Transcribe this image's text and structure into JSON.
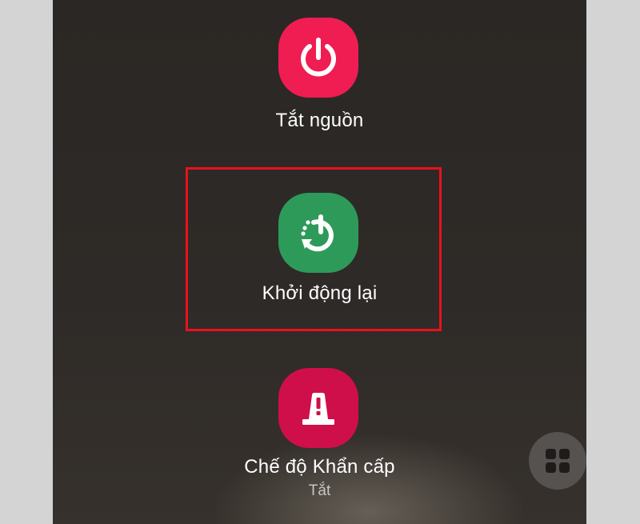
{
  "power_menu": {
    "options": [
      {
        "label": "Tắt nguồn",
        "icon": "power-icon",
        "color": "#ef1d52"
      },
      {
        "label": "Khởi động lại",
        "icon": "restart-icon",
        "color": "#2e9a5a",
        "highlighted": true
      },
      {
        "label": "Chế độ Khẩn cấp",
        "sublabel": "Tắt",
        "icon": "emergency-beacon-icon",
        "color": "#cf0f4a"
      }
    ],
    "grid_button": {
      "icon": "grid-icon"
    },
    "highlight_color": "#e8121c"
  }
}
